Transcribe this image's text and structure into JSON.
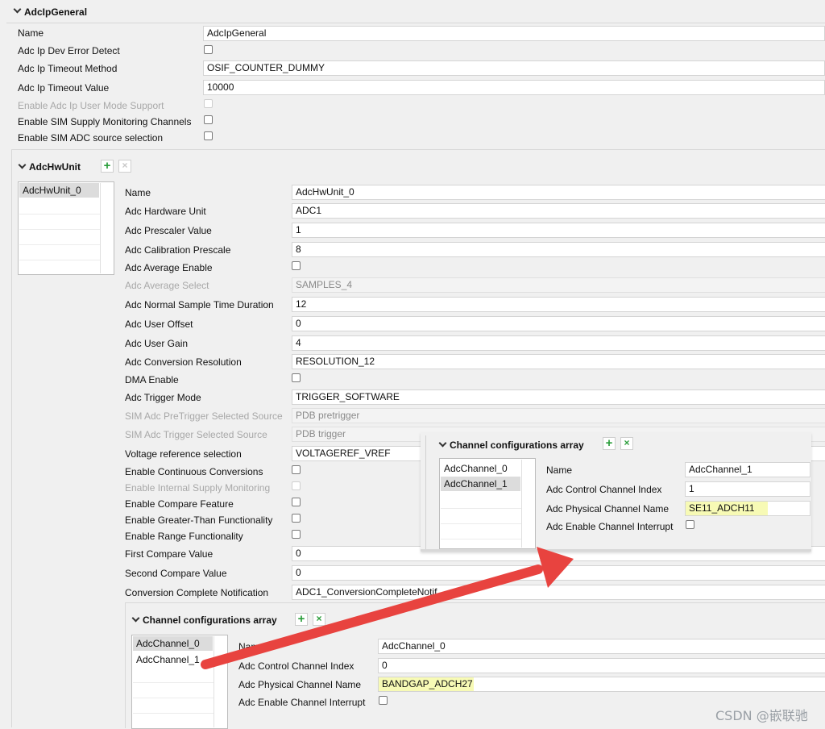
{
  "general": {
    "title": "AdcIpGeneral",
    "rows": [
      {
        "label": "Name",
        "value": "AdcIpGeneral"
      },
      {
        "label": "Adc Ip Dev Error Detect"
      },
      {
        "label": "Adc Ip Timeout Method",
        "value": "OSIF_COUNTER_DUMMY"
      },
      {
        "label": "Adc Ip Timeout Value",
        "value": "10000"
      },
      {
        "label": "Enable Adc Ip User Mode Support"
      },
      {
        "label": "Enable SIM Supply Monitoring Channels"
      },
      {
        "label": "Enable SIM ADC source selection"
      }
    ]
  },
  "hwunit": {
    "title": "AdcHwUnit",
    "list": [
      "AdcHwUnit_0"
    ],
    "rows": [
      {
        "label": "Name",
        "value": "AdcHwUnit_0"
      },
      {
        "label": "Adc Hardware Unit",
        "value": "ADC1"
      },
      {
        "label": "Adc Prescaler Value",
        "value": "1"
      },
      {
        "label": "Adc Calibration Prescale",
        "value": "8"
      },
      {
        "label": "Adc Average Enable"
      },
      {
        "label": "Adc Average Select",
        "value": "SAMPLES_4"
      },
      {
        "label": "Adc Normal Sample Time Duration",
        "value": "12"
      },
      {
        "label": "Adc User Offset",
        "value": "0"
      },
      {
        "label": "Adc User Gain",
        "value": "4"
      },
      {
        "label": "Adc Conversion Resolution",
        "value": "RESOLUTION_12"
      },
      {
        "label": "DMA Enable"
      },
      {
        "label": "Adc Trigger Mode",
        "value": "TRIGGER_SOFTWARE"
      },
      {
        "label": "SIM Adc PreTrigger Selected Source",
        "value": "PDB pretrigger"
      },
      {
        "label": "SIM Adc Trigger Selected Source",
        "value": "PDB trigger"
      },
      {
        "label": "Voltage reference selection",
        "value": "VOLTAGEREF_VREF"
      },
      {
        "label": "Enable Continuous Conversions"
      },
      {
        "label": "Enable Internal Supply Monitoring"
      },
      {
        "label": "Enable Compare Feature"
      },
      {
        "label": "Enable Greater-Than Functionality"
      },
      {
        "label": "Enable Range Functionality"
      },
      {
        "label": "First Compare Value",
        "value": "0"
      },
      {
        "label": "Second Compare Value",
        "value": "0"
      },
      {
        "label": "Conversion Complete Notification",
        "value": "ADC1_ConversionCompleteNotif"
      }
    ]
  },
  "channels_bottom": {
    "title": "Channel configurations array",
    "list": [
      "AdcChannel_0",
      "AdcChannel_1"
    ],
    "rows": [
      {
        "label": "Name",
        "value": "AdcChannel_0"
      },
      {
        "label": "Adc Control Channel Index",
        "value": "0"
      },
      {
        "label": "Adc Physical Channel Name",
        "value": "BANDGAP_ADCH27"
      },
      {
        "label": "Adc Enable Channel Interrupt"
      }
    ]
  },
  "channels_overlay": {
    "title": "Channel configurations array",
    "list": [
      "AdcChannel_0",
      "AdcChannel_1"
    ],
    "rows": [
      {
        "label": "Name",
        "value": "AdcChannel_1"
      },
      {
        "label": "Adc Control Channel Index",
        "value": "1"
      },
      {
        "label": "Adc Physical Channel Name",
        "value": "SE11_ADCH11"
      },
      {
        "label": "Adc Enable Channel Interrupt"
      }
    ]
  },
  "toolbar": {
    "add": "+",
    "remove": "×"
  },
  "watermark": "CSDN @嵌联驰",
  "colors": {
    "arrow": "#e8433f",
    "highlight": "#f0f578",
    "add_green": "#2a9d3a"
  }
}
